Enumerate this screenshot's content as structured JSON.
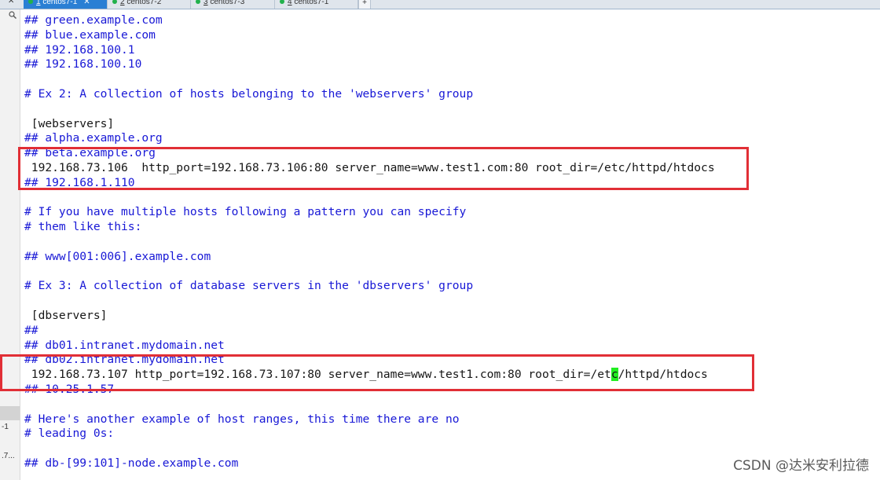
{
  "tabs": [
    {
      "index": "1",
      "name": "centos7-1",
      "active": true
    },
    {
      "index": "2",
      "name": "centos7-2",
      "active": false
    },
    {
      "index": "3",
      "name": "centos7-3",
      "active": false
    },
    {
      "index": "4",
      "name": "centos7-1",
      "active": false
    }
  ],
  "tab_add_label": "+",
  "side": {
    "label1": "-1",
    "label2": ".7..."
  },
  "editor_lines": [
    {
      "text": "## green.example.com"
    },
    {
      "text": "## blue.example.com"
    },
    {
      "text": "## 192.168.100.1"
    },
    {
      "text": "## 192.168.100.10"
    },
    {
      "text": ""
    },
    {
      "text": "# Ex 2: A collection of hosts belonging to the 'webservers' group"
    },
    {
      "text": ""
    },
    {
      "text": " [webservers]",
      "plain": true
    },
    {
      "text": "## alpha.example.org"
    },
    {
      "text": "## beta.example.org"
    },
    {
      "text": " 192.168.73.106  http_port=192.168.73.106:80 server_name=www.test1.com:80 root_dir=/etc/httpd/htdocs",
      "plain": true
    },
    {
      "text": "## 192.168.1.110"
    },
    {
      "text": ""
    },
    {
      "text": "# If you have multiple hosts following a pattern you can specify"
    },
    {
      "text": "# them like this:"
    },
    {
      "text": ""
    },
    {
      "text": "## www[001:006].example.com"
    },
    {
      "text": ""
    },
    {
      "text": "# Ex 3: A collection of database servers in the 'dbservers' group"
    },
    {
      "text": ""
    },
    {
      "text": " [dbservers]",
      "plain": true
    },
    {
      "text": "##"
    },
    {
      "text": "## db01.intranet.mydomain.net"
    },
    {
      "text": "## db02.intranet.mydomain.net"
    },
    {
      "pre": " 192.168.73.107 http_port=192.168.73.107:80 server_name=www.test1.com:80 root_dir=/et",
      "cursor": "c",
      "post": "/httpd/htdocs",
      "plain": true
    },
    {
      "text": "## 10.25.1.57"
    },
    {
      "text": ""
    },
    {
      "text": "# Here's another example of host ranges, this time there are no"
    },
    {
      "text": "# leading 0s:"
    },
    {
      "text": ""
    },
    {
      "text": "## db-[99:101]-node.example.com"
    }
  ],
  "watermark": "CSDN @达米安利拉德"
}
